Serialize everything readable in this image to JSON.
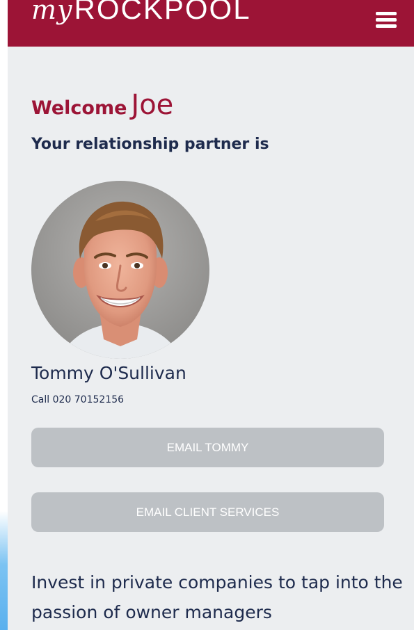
{
  "header": {
    "logo_my": "my",
    "logo_brand": "ROCKPOOL",
    "menu_icon": "hamburger-menu-icon"
  },
  "welcome": {
    "word": "Welcome",
    "name": "Joe"
  },
  "partner": {
    "heading": "Your relationship partner is",
    "name": "Tommy O'Sullivan",
    "phone": "Call 020 70152156"
  },
  "actions": {
    "email_partner_label": "EMAIL TOMMY",
    "email_client_services_label": "EMAIL CLIENT SERVICES"
  },
  "tagline": "Invest in private companies to tap into the passion of owner managers",
  "colors": {
    "brand": "#9c1436",
    "text_navy": "#1e2b4d",
    "background": "#eceef0",
    "button_bg": "#bdc1c5"
  }
}
